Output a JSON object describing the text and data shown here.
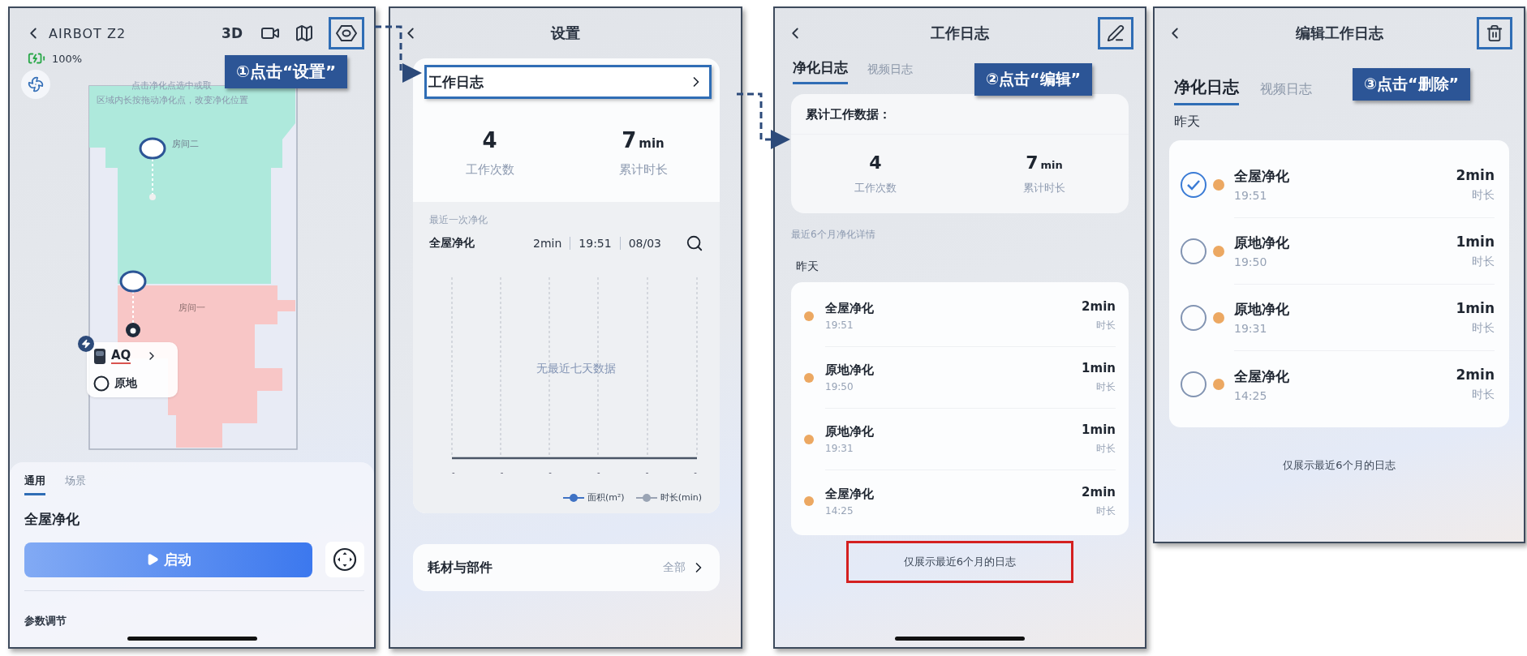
{
  "device_screen": {
    "title": "AIRBOT Z2",
    "mode_button": "3D",
    "battery": "100%",
    "callout": "①点击“设置”",
    "map": {
      "hint_lines": [
        "点击净化点选中或取",
        "区域内长按拖动净化点，改变净化位置"
      ],
      "rooms": [
        "房间二",
        "房间一"
      ],
      "device": {
        "name": "AQ",
        "mode": "原地"
      }
    },
    "tabs": [
      {
        "label": "通用",
        "selected": true
      },
      {
        "label": "场景",
        "selected": false
      }
    ],
    "mode_title": "全屋净化",
    "start_button": "启动",
    "section_label": "参数调节"
  },
  "settings_screen": {
    "title": "设置",
    "log_row": "工作日志",
    "stats": [
      {
        "value": "4",
        "label": "工作次数"
      },
      {
        "value": "7",
        "unit": "min",
        "label": "累计时长"
      }
    ],
    "last_run": {
      "heading": "最近一次净化",
      "mode": "全屋净化",
      "fields": [
        "2min",
        "19:51",
        "08/03"
      ]
    },
    "chart": {
      "empty_message": "无最近七天数据",
      "x_labels": [
        "-",
        "-",
        "-",
        "-",
        "-",
        "-"
      ],
      "legend": [
        {
          "label": "面积(m²)",
          "color": "#3f72c4"
        },
        {
          "label": "时长(min)",
          "color": "#9aa4b4"
        }
      ]
    },
    "parts_row": {
      "label": "耗材与部件",
      "value": "全部"
    }
  },
  "log_screen": {
    "title": "工作日志",
    "callout": "②点击“编辑”",
    "tabs": [
      {
        "label": "净化日志",
        "selected": true
      },
      {
        "label": "视频日志",
        "selected": false
      }
    ],
    "summary": {
      "heading": "累计工作数据：",
      "stats": [
        {
          "value": "4",
          "label": "工作次数"
        },
        {
          "value": "7",
          "unit": "min",
          "label": "累计时长"
        }
      ]
    },
    "section_label": "最近6个月净化详情",
    "day_label": "昨天",
    "entries": [
      {
        "name": "全屋净化",
        "time": "19:51",
        "duration": "2min",
        "duration_label": "时长"
      },
      {
        "name": "原地净化",
        "time": "19:50",
        "duration": "1min",
        "duration_label": "时长"
      },
      {
        "name": "原地净化",
        "time": "19:31",
        "duration": "1min",
        "duration_label": "时长"
      },
      {
        "name": "全屋净化",
        "time": "14:25",
        "duration": "2min",
        "duration_label": "时长"
      }
    ],
    "footer": "仅展示最近6个月的日志"
  },
  "edit_log_screen": {
    "title": "编辑工作日志",
    "callout": "③点击“删除”",
    "tabs": [
      {
        "label": "净化日志",
        "selected": true
      },
      {
        "label": "视频日志",
        "selected": false
      }
    ],
    "day_label": "昨天",
    "entries": [
      {
        "name": "全屋净化",
        "time": "19:51",
        "duration": "2min",
        "duration_label": "时长",
        "checked": true
      },
      {
        "name": "原地净化",
        "time": "19:50",
        "duration": "1min",
        "duration_label": "时长",
        "checked": false
      },
      {
        "name": "原地净化",
        "time": "19:31",
        "duration": "1min",
        "duration_label": "时长",
        "checked": false
      },
      {
        "name": "全屋净化",
        "time": "14:25",
        "duration": "2min",
        "duration_label": "时长",
        "checked": false
      }
    ],
    "footer": "仅展示最近6个月的日志"
  }
}
